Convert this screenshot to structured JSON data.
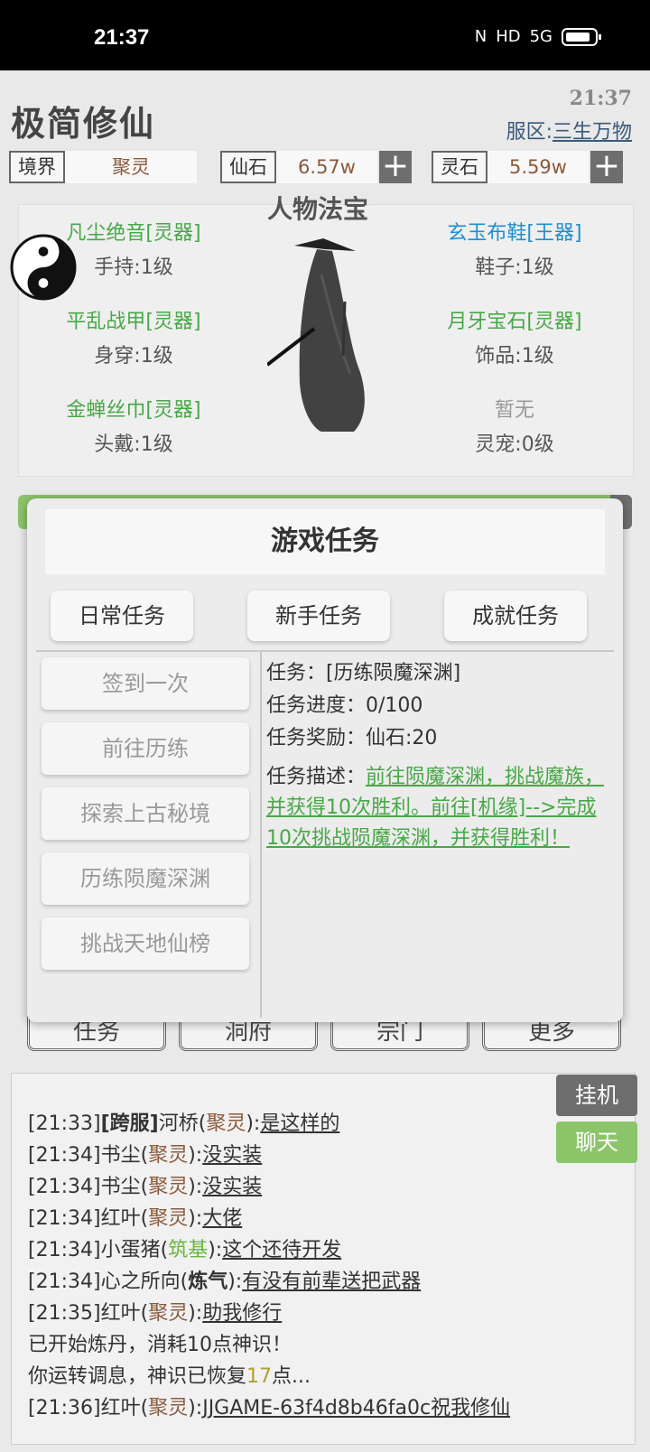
{
  "status_bar": {
    "time": "21:37",
    "nfc": "N",
    "hd": "HD",
    "network": "5G"
  },
  "header": {
    "app_title": "极简修仙",
    "clock": "21:37",
    "server_label": "服区:",
    "server_name": "三生万物"
  },
  "resources": [
    {
      "label": "境界",
      "value": "聚灵"
    },
    {
      "label": "仙石",
      "value": "6.57w",
      "plus": "+"
    },
    {
      "label": "灵石",
      "value": "5.59w",
      "plus": "+"
    }
  ],
  "equipment": {
    "title": "人物法宝",
    "slots": [
      {
        "name": "凡尘绝音[灵器]",
        "slot": "手持:1级"
      },
      {
        "name": "玄玉布鞋[王器]",
        "slot": "鞋子:1级"
      },
      {
        "name": "平乱战甲[灵器]",
        "slot": "身穿:1级"
      },
      {
        "name": "月牙宝石[灵器]",
        "slot": "饰品:1级"
      },
      {
        "name": "金蝉丝巾[灵器]",
        "slot": "头戴:1级"
      },
      {
        "name": "暂无",
        "slot": "灵宠:0级"
      }
    ]
  },
  "bottom_tabs": [
    "任务",
    "洞府",
    "宗门",
    "更多"
  ],
  "modal": {
    "title": "游戏任务",
    "tabs": [
      "日常任务",
      "新手任务",
      "成就任务"
    ],
    "tasks": [
      "签到一次",
      "前往历练",
      "探索上古秘境",
      "历练陨魔深渊",
      "挑战天地仙榜"
    ],
    "detail": {
      "task": "任务：[历练陨魔深渊]",
      "progress": "任务进度：0/100",
      "reward": "任务奖励：仙石:20",
      "desc_label": "任务描述：",
      "desc": "前往陨魔深渊，挑战魔族，并获得10次胜利。前往[机缘]-->完成10次挑战陨魔深渊，并获得胜利！"
    }
  },
  "chat": {
    "side_buttons": {
      "idle": "挂机",
      "chat": "聊天"
    },
    "lines": [
      {
        "time": "[21:33]",
        "tag": "[跨服]",
        "name": "河桥",
        "realm": "聚灵",
        "msg": "是这样的"
      },
      {
        "time": "[21:34]",
        "name": "书尘",
        "realm": "聚灵",
        "msg": "没实装"
      },
      {
        "time": "[21:34]",
        "name": "书尘",
        "realm": "聚灵",
        "msg": "没实装"
      },
      {
        "time": "[21:34]",
        "name": "红叶",
        "realm": "聚灵",
        "msg": "大佬"
      },
      {
        "time": "[21:34]",
        "name": "小蛋猪",
        "realm": "筑基",
        "msg": "这个还待开发"
      },
      {
        "time": "[21:34]",
        "name": "心之所向",
        "realm": "炼气",
        "msg": "有没有前辈送把武器"
      },
      {
        "time": "[21:35]",
        "name": "红叶",
        "realm": "聚灵",
        "msg": "助我修行"
      }
    ],
    "sys1": "已开始炼丹，消耗10点神识！",
    "sys2_a": "你运转调息，神识已恢复",
    "sys2_num": "17",
    "sys2_b": "点...",
    "last": {
      "time": "[21:36]",
      "name": "红叶",
      "realm": "聚灵",
      "msg": "JJGAME-63f4d8b46fa0c祝我修仙"
    }
  }
}
